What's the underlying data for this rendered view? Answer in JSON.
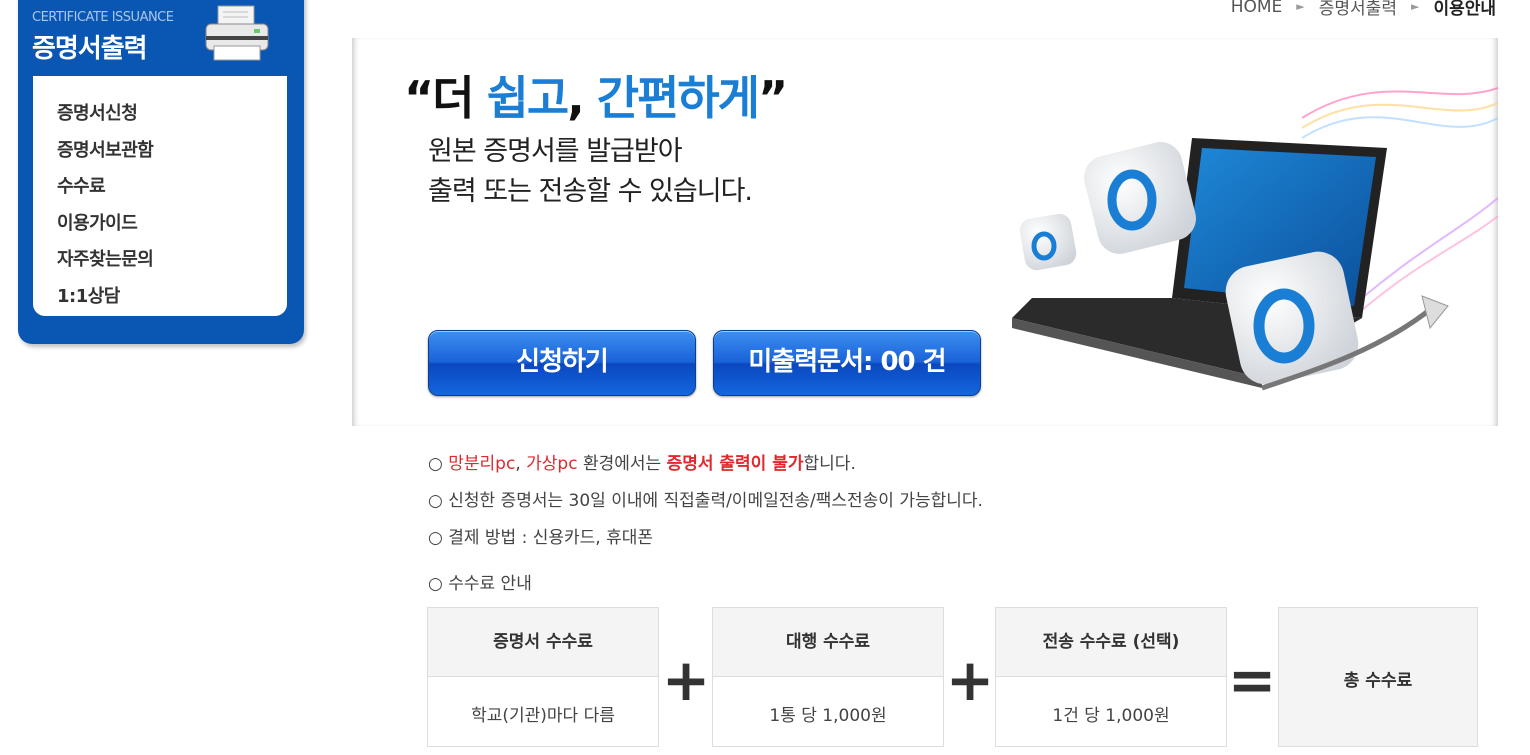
{
  "sidebar": {
    "subtitle": "CERTIFICATE ISSUANCE",
    "title": "증명서출력",
    "items": [
      "증명서신청",
      "증명서보관함",
      "수수료",
      "이용가이드",
      "자주찾는문의",
      "1:1상담"
    ]
  },
  "breadcrumb": {
    "home": "HOME",
    "section": "증명서출력",
    "current": "이용안내"
  },
  "banner": {
    "headline_open": "“더 ",
    "headline_blue1": "쉽고",
    "headline_mid": ", ",
    "headline_blue2": "간편하게",
    "headline_close": "”",
    "line1": "원본 증명서를 발급받아",
    "line2": "출력 또는 전송할 수 있습니다.",
    "apply_button": "신청하기",
    "unprinted_button": "미출력문서: 00 건"
  },
  "notices": {
    "n1_prefix": "○ ",
    "n1_red1": "망분리pc",
    "n1_comma": ", ",
    "n1_red2": "가상pc",
    "n1_mid": " 환경에서는 ",
    "n1_bold": "증명서 출력이 불가",
    "n1_suffix": "합니다.",
    "n2": "○ 신청한 증명서는 30일 이내에 직접출력/이메일전송/팩스전송이 가능합니다.",
    "n3": "○ 결제 방법 : 신용카드, 휴대폰",
    "fee_heading": "○ 수수료 안내"
  },
  "fees": {
    "cert_header": "증명서 수수료",
    "cert_value": "학교(기관)마다 다름",
    "agency_header": "대행 수수료",
    "agency_value": "1통 당 1,000원",
    "send_header": "전송 수수료 (선택)",
    "send_value": "1건 당 1,000원",
    "plus": "+",
    "equals": "=",
    "total_header": "총 수수료"
  },
  "colors": {
    "brand_blue": "#0a56b3",
    "accent_blue": "#1a7fd4",
    "alert_red": "#e0282f"
  }
}
